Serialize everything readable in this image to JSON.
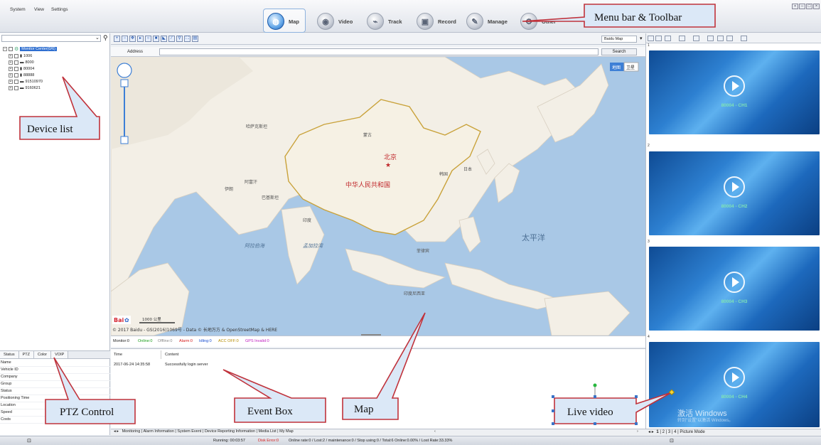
{
  "menu": {
    "items": [
      "System",
      "View",
      "Settings"
    ]
  },
  "toolbar": {
    "buttons": [
      {
        "label": "Map",
        "icon": "globe-icon",
        "active": true
      },
      {
        "label": "Video",
        "icon": "camera-icon",
        "active": false
      },
      {
        "label": "Track",
        "icon": "track-icon",
        "active": false
      },
      {
        "label": "Record",
        "icon": "record-icon",
        "active": false
      },
      {
        "label": "Manage",
        "icon": "manage-icon",
        "active": false
      },
      {
        "label": "Other",
        "icon": "other-icon",
        "active": false
      }
    ]
  },
  "device_tree": {
    "root": "Monitor Center(0/6)",
    "devices": [
      "1006",
      "8000",
      "80004",
      "88888",
      "91510970",
      "9160621"
    ]
  },
  "status_panel": {
    "tabs": [
      "Status",
      "PTZ",
      "Color",
      "VOIP"
    ],
    "fields": [
      "Name",
      "Vehicle ID",
      "Company",
      "Group",
      "Status",
      "Positioning Time",
      "Location",
      "Speed",
      "Costs"
    ]
  },
  "map_panel": {
    "address_label": "Address",
    "search_label": "Search",
    "map_source": "Baidu Map",
    "map_type_buttons": [
      "地图",
      "卫星"
    ],
    "copyright": "© 2017 Baidu - GS(2016)1069号 - Data © 长地万方 & OpenStreetMap & HERE",
    "scale": "1000 公里",
    "labels": {
      "beijing": "北京",
      "china": "中华人民共和国",
      "mongolia": "蒙古",
      "kazakhstan": "哈萨克斯坦",
      "pacific": "太平洋",
      "japan": "日本",
      "korea": "韩国",
      "india": "印度",
      "indonesia": "印度尼西亚",
      "philippines": "菲律宾",
      "arabian_sea": "阿拉伯海",
      "bay_of_bengal": "孟加拉湾",
      "iran": "伊朗",
      "afghanistan": "阿富汗",
      "pakistan": "巴基斯坦"
    },
    "legend": [
      {
        "label": "Monitor:0",
        "color": "#222222"
      },
      {
        "label": "Online:0",
        "color": "#1a9d1a"
      },
      {
        "label": "Offline:0",
        "color": "#888888"
      },
      {
        "label": "Alarm:0",
        "color": "#d62020"
      },
      {
        "label": "Idling:0",
        "color": "#1a4fd0"
      },
      {
        "label": "ACC OFF:0",
        "color": "#b58c00"
      },
      {
        "label": "GPS Invalid:0",
        "color": "#c020c0"
      }
    ]
  },
  "event_box": {
    "columns": [
      "Time",
      "Content"
    ],
    "rows": [
      {
        "time": "2017-06-24 14:35:58",
        "content": "Successfully login server"
      }
    ]
  },
  "bottom_tabs": [
    "Monitoring",
    "Alarm Information",
    "System Event",
    "Device Reporting Information",
    "Media List",
    "My Map"
  ],
  "video_panel": {
    "channels": [
      {
        "index": "1",
        "caption": "80004 - CH1"
      },
      {
        "index": "2",
        "caption": "80004 - CH2"
      },
      {
        "index": "3",
        "caption": "80004 - CH3"
      },
      {
        "index": "4",
        "caption": "80004 - CH4"
      }
    ],
    "watermark": "激活 Windows",
    "watermark_sub": "转到\"设置\"以激活 Windows。",
    "pages": [
      "1",
      "2",
      "3",
      "4",
      "Picture Mode"
    ]
  },
  "statusbar": {
    "running": "Running: 00:03:57",
    "disk_error": "Disk Error:0",
    "stats": "Online rate:0 / Lost:2 / maintenance:0 / Stop using:0 / Total:6   Online:0.00% / Lost Rate:33.33%"
  },
  "annotations": {
    "menu_toolbar": "Menu bar & Toolbar",
    "device_list": "Device list",
    "ptz_control": "PTZ Control",
    "event_box": "Event Box",
    "map": "Map",
    "live_video": "Live video"
  }
}
